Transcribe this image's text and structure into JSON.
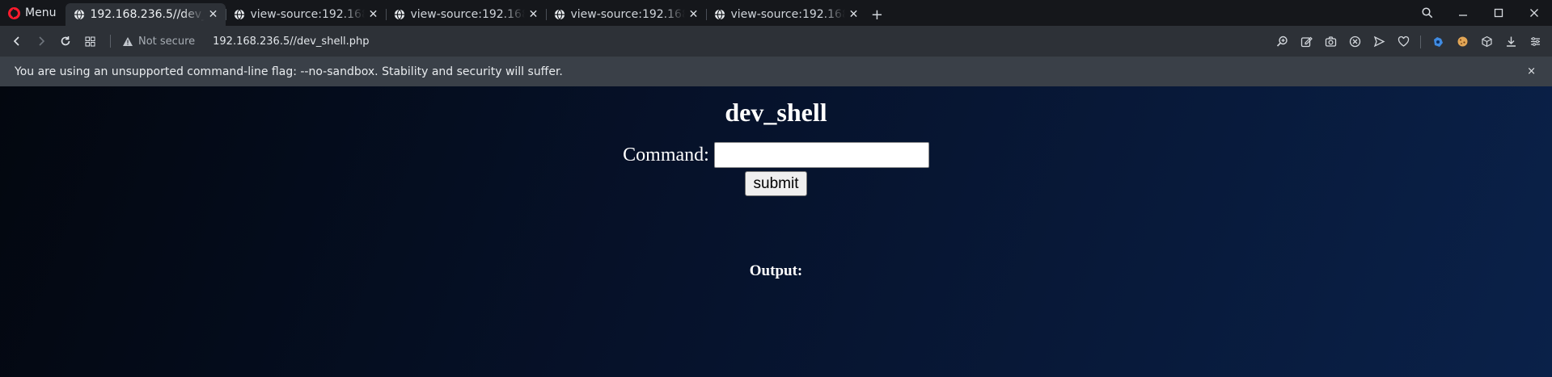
{
  "browser": {
    "menu_label": "Menu",
    "tabs": [
      {
        "title": "192.168.236.5//dev_shell.php",
        "active": true
      },
      {
        "title": "view-source:192.168.236.5",
        "active": false
      },
      {
        "title": "view-source:192.168.236.5",
        "active": false
      },
      {
        "title": "view-source:192.168.236.5",
        "active": false
      },
      {
        "title": "view-source:192.168.236.5",
        "active": false
      }
    ],
    "new_tab": "+",
    "security_label": "Not secure",
    "url": "192.168.236.5//dev_shell.php",
    "icons": {
      "back": "chevron-left-icon",
      "forward": "chevron-right-icon",
      "reload": "reload-icon",
      "tabs_grid": "grid-icon",
      "warning": "warning-triangle-icon",
      "right_toolbar": [
        "zoom-icon",
        "edit-icon",
        "camera-icon",
        "shield-icon",
        "send-icon",
        "heart-icon",
        "extension-icon",
        "cookie-icon",
        "cube-icon",
        "download-icon",
        "easy-setup-icon"
      ]
    }
  },
  "infobar": {
    "message": "You are using an unsupported command-line flag: --no-sandbox. Stability and security will suffer.",
    "close": "×"
  },
  "page": {
    "heading": "dev_shell",
    "command_label": "Command:",
    "command_value": "",
    "submit_label": "submit",
    "output_label": "Output:"
  },
  "colors": {
    "page_bg_start": "#03070f",
    "page_bg_end": "#0a2149",
    "toolbar": "#2d3137",
    "infobar": "#3a4048",
    "tabstrip": "#15171b",
    "opera_red": "#ff1b2d"
  }
}
